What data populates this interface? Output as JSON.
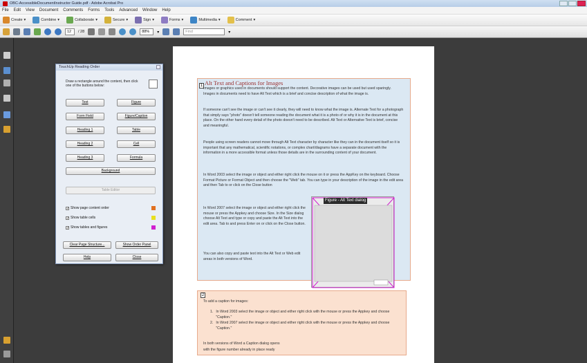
{
  "window": {
    "title": "OBC-AccessibleDocumentInstructor Guide.pdf - Adobe Acrobat Pro"
  },
  "menu": [
    "File",
    "Edit",
    "View",
    "Document",
    "Comments",
    "Forms",
    "Tools",
    "Advanced",
    "Window",
    "Help"
  ],
  "toolbar1": {
    "create": "Create",
    "combine": "Combine",
    "collaborate": "Collaborate",
    "secure": "Secure",
    "sign": "Sign",
    "forms": "Forms",
    "multimedia": "Multimedia",
    "comment": "Comment"
  },
  "toolbar2": {
    "page_current": "12",
    "page_total": "/ 28",
    "zoom": "88%",
    "find_placeholder": "Find"
  },
  "dialog": {
    "title": "TouchUp Reading Order",
    "instructions": "Draw a rectangle around the content, then click one of the buttons below:",
    "buttons": {
      "text": "Text",
      "figure": "Figure",
      "form_field": "Form Field",
      "figure_caption": "Figure/Caption",
      "heading1": "Heading 1",
      "table": "Table",
      "heading2": "Heading 2",
      "cell": "Cell",
      "heading3": "Heading 3",
      "formula": "Formula",
      "background": "Background",
      "table_editor": "Table Editor",
      "clear_structure": "Clear Page Structure...",
      "show_order_panel": "Show Order Panel",
      "help": "Help",
      "close": "Close"
    },
    "checkboxes": [
      {
        "label": "Show page content order",
        "color": "#e07020"
      },
      {
        "label": "Show table cells",
        "color": "#e8e020"
      },
      {
        "label": "Show tables and figures",
        "color": "#d020d0"
      }
    ]
  },
  "document": {
    "heading": "Alt Text and Captions for Images",
    "tag1": "1",
    "p1": "Images or graphics used in documents should support the content. Decorative images can be used but used sparingly. Images in documents need to have Alt Text which is a brief and concise description of what the image is.",
    "p2": "If someone can't see the image or can't see it clearly, they will need to know what the image is. Alternate Text for a photograph that simply says \"photo\" doesn't tell someone reading the document what it is a photo of or why it is in the document at this place. On the other hand every detail of the photo doesn't need to be described. Alt Text or Alternative Text is brief, concise and meaningful.",
    "p3": "People using screen readers cannot move through Alt Text character by character like they can in the document itself so it is important that any mathematical, scientific notations, or complex chart/diagrams have a separate document with the information in a more accessible format unless those details are in the surrounding content of your document.",
    "p4": "In Word 2003 select the image or object and either right click the mouse on it or press the AppKey on the keyboard. Choose Format Picture or Format Object and then choose the \"Web\" tab. You can type in your description of the image in the edit area and then Tab to or click on the Close button",
    "p5": "In Word 2007 select the image or object and either right click the mouse or press the Appkey and choose Size. In the Size dialog choose Alt Text and type or copy and paste the Alt Text into the edit area. Tab to and press Enter on or click on the Close button.",
    "p6": "You can also copy and paste text into the Alt Text or Web edit areas in both versions of Word.",
    "figure_tag": "Figure - Alt Text dialog",
    "tag2": "2",
    "caption_intro": "To add a caption for images:",
    "caption_items": [
      "In Word 2003 select the image or object and either right click with the mouse or press the Appkey and choose \"Caption.\"",
      "In Word 2007 select the image or object and either right click with the mouse or press the Appkey and choose \"Caption.\""
    ],
    "caption_outro_1": "In both versions of Word a Caption dialog opens",
    "caption_outro_2": "with the figure number already in place ready"
  }
}
